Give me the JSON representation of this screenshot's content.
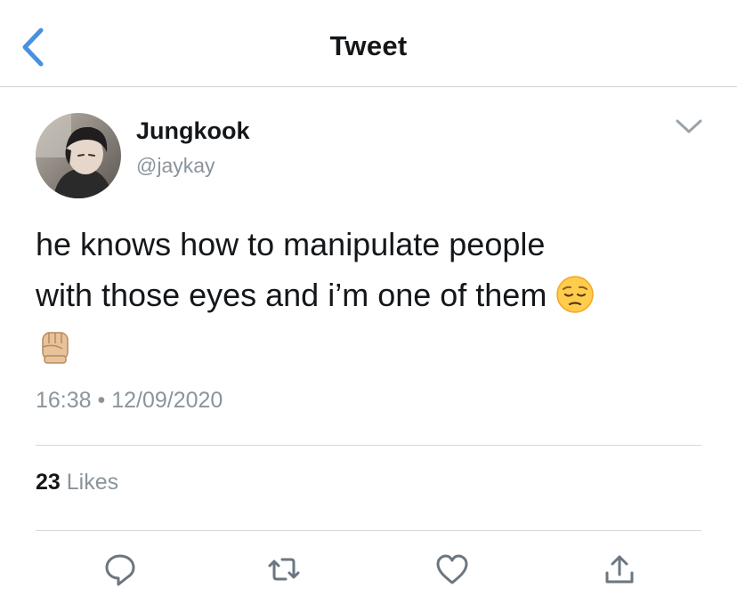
{
  "header": {
    "title": "Tweet",
    "back_icon": "chevron-left-icon",
    "accent_color": "#4a90e2"
  },
  "tweet": {
    "author_name": "Jungkook",
    "author_handle": "@jaykay",
    "text_line1": "he knows how to manipulate people",
    "text_line2": "with those eyes and i’m one of them ",
    "emojis": [
      "pensive-face",
      "raised-fist"
    ],
    "time": "16:38",
    "separator": " • ",
    "date": "12/09/2020"
  },
  "stats": {
    "likes_count": "23",
    "likes_label": " Likes"
  },
  "actions": [
    "reply-icon",
    "retweet-icon",
    "like-icon",
    "share-icon"
  ]
}
